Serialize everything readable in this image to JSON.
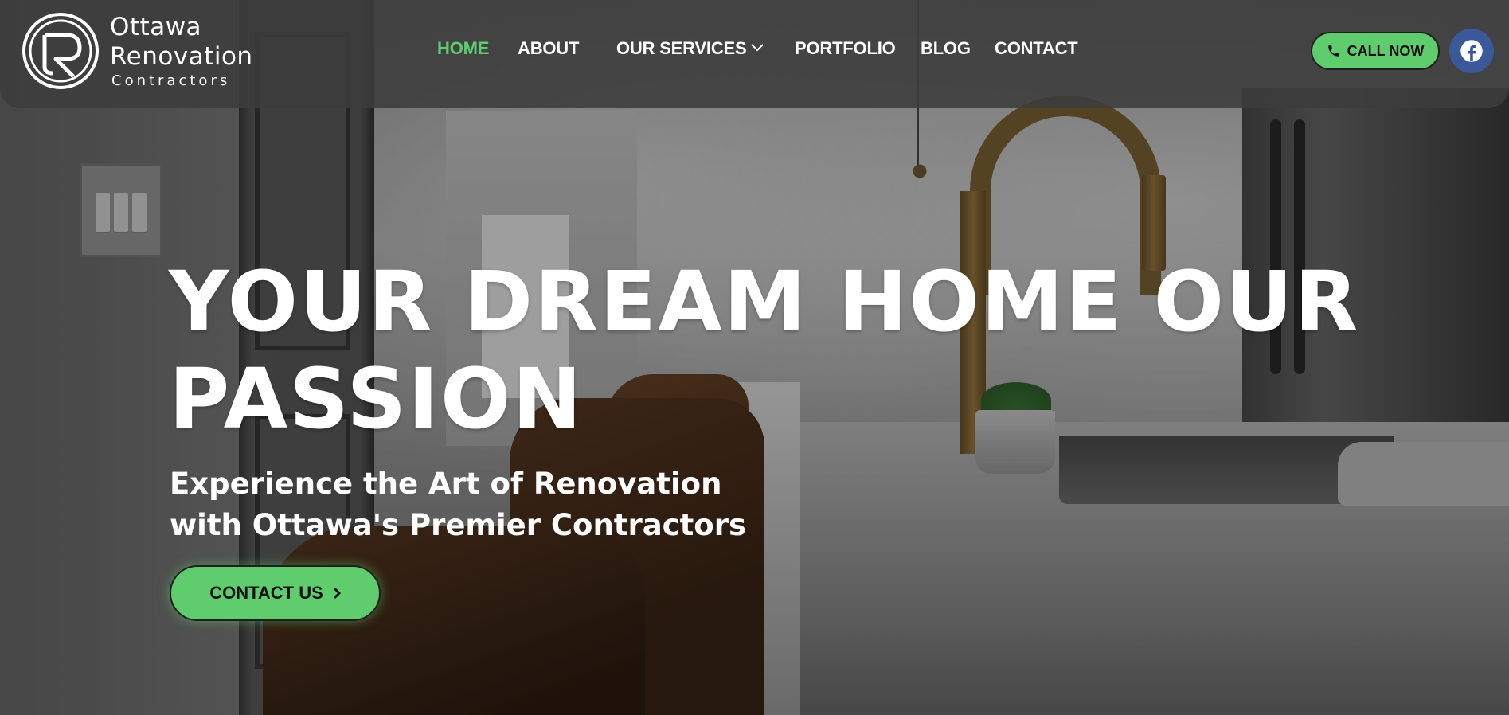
{
  "brand": {
    "name_line1": "Ottawa",
    "name_line2": "Renovation",
    "name_line3": "Contractors",
    "accent_color": "#5fcd6e",
    "facebook_color": "#3b5998"
  },
  "nav": {
    "items": [
      {
        "label": "HOME",
        "active": true
      },
      {
        "label": "ABOUT",
        "active": false
      },
      {
        "label": "OUR SERVICES",
        "active": false,
        "has_dropdown": true
      },
      {
        "label": "PORTFOLIO",
        "active": false
      },
      {
        "label": "BLOG",
        "active": false
      },
      {
        "label": "CONTACT",
        "active": false
      }
    ]
  },
  "header_actions": {
    "call_label": "CALL NOW",
    "call_icon": "phone-icon",
    "social_icon": "facebook-icon"
  },
  "hero": {
    "title_line1": "YOUR DREAM HOME OUR",
    "title_line2": "PASSION",
    "subtitle_line1": "Experience the Art of Renovation",
    "subtitle_line2": "with Ottawa's Premier Contractors",
    "cta_label": "CONTACT US",
    "cta_icon": "chevron-right-icon"
  }
}
